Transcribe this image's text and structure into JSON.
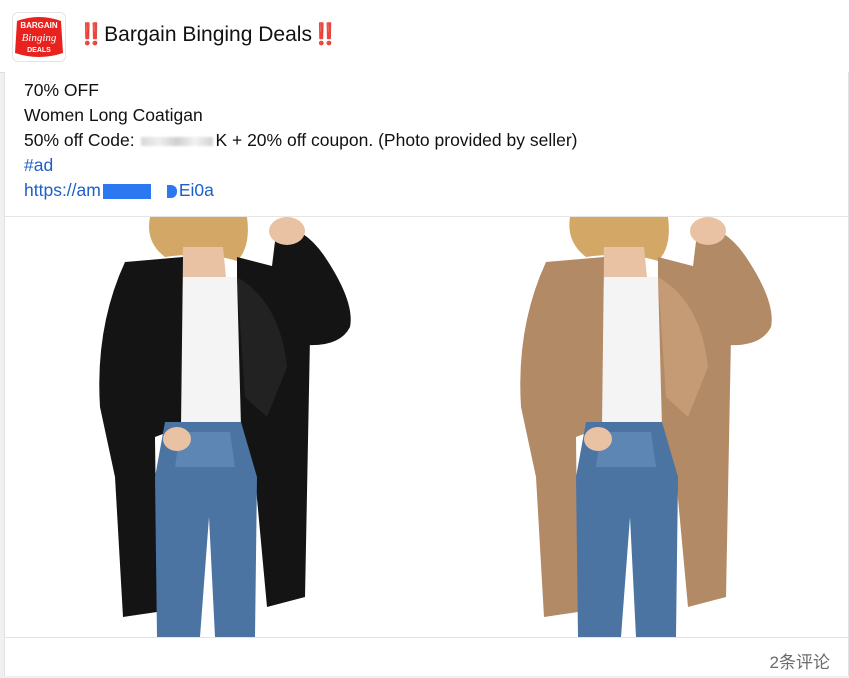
{
  "page": {
    "avatar": {
      "logo_lines": [
        "BARGAIN",
        "Binging",
        "DEALS"
      ],
      "brand_color": "#e8231f"
    },
    "name": "‼️Bargain Binging Deals‼️"
  },
  "post": {
    "lines": {
      "discount": "70% OFF",
      "product": "Women Long Coatigan",
      "code_prefix": "50% off Code: ",
      "code_suffix": "K + 20% off coupon. (Photo provided by seller)",
      "hashtag": "#ad",
      "link_prefix": "https://am",
      "link_suffix": "Ei0a"
    },
    "link_color": "#1c5fc9",
    "images": [
      {
        "icon": "woman-black-coatigan-photo",
        "coat_color": "#141414"
      },
      {
        "icon": "woman-camel-coatigan-photo",
        "coat_color": "#b38a66"
      }
    ]
  },
  "footer": {
    "comments_count": "2条评论"
  }
}
